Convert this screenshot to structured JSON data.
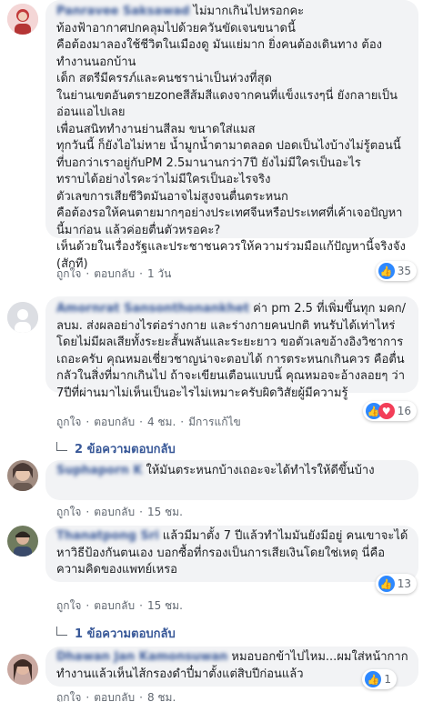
{
  "comments": [
    {
      "author": "Panravee Saksawad",
      "text": "ไม่มากเกินไปหรอกคะ\nท้องฟ้าอากาศปกคลุมไปด้วยควันขัดเจนขนาดนี้\nคือต้องมาลองใช้ชีวิตในเมืองดู มันแย่มาก ยิ่งคนต้องเดินทาง ต้องทำงานนอกบ้าน\nเด็ก สตรีมีครรภ์และคนชราน่าเป็นห่วงที่สุด\nในย่านเขตอันตรายzoneสีส้มสีแดงจากคนที่แข็งแรงๆนี่ ยังกลายเป็นอ่อนแอไปเลย\nเพื่อนสนิททำงานย่านสีลม ขนาดใส่แมส\nทุกวันนี้ ก็ยังไอไม่หาย น้ำมูกน้ำตามาตลอด ปอดเป็นไงบ้างไม่รู้ตอนนี้\nที่บอกว่าเราอยู่กับPM 2.5มานานกว่า7ปี ยังไม่มีใครเป็นอะไร\nทราบได้อย่างไรคะว่าไม่มีใครเป็นอะไรจริง\nตัวเลขการเสียชีวิตมันอาจไม่สูงจนตื่นตระหนก\nคือต้องรอให้คนตายมากๆอย่างประเทศจีนหรือประเทศที่เค้าเจอปัญหานี้มาก่อน แล้วค่อยตื่นตัวหรอคะ?\nเห็นด้วยในเรื่องรัฐและประชาชนควรให้ความร่วมมือแก้ปัญหานี้จริงจัง (สักที)",
      "like": "ถูกใจ",
      "reply": "ตอบกลับ",
      "time": "1 วัน",
      "reactions": "35"
    },
    {
      "author": "Amornrat Sansonthonankhet",
      "text": "ค่า pm 2.5 ที่เพิ่มขึ้นทุก มคก/ลบม. ส่งผลอย่างไรต่อร่างกาย และร่างกายคนปกติ ทนรับได้เท่าไหร่โดยไม่มีผลเสียทั้งระยะสั้นพลันและระยะยาว ขอตัวเลขอ้างอิงวิชาการเถอะครับ คุณหมอเชี่ยวชาญน่าจะตอบได้ การตระหนกเกินควร คือตื่นกลัวในสิ่งที่มากเกินไป ถ้าจะเขียนเตือนแบบนี้ คุณหมอจะอ้างลอยๆ ว่า 7ปีที่ผ่านมาไม่เห็นเป็นอะไรไม่เหมาะครับผิดวิสัยผู้มีความรู้",
      "like": "ถูกใจ",
      "reply": "ตอบกลับ",
      "time": "4 ชม.",
      "edited": "มีการแก้ไข",
      "reactions": "16",
      "replies": "2 ข้อความตอบกลับ"
    },
    {
      "author": "Suphaporn K",
      "text": "ให้มันตระหนกบ้างเถอะจะได้ทำไรให้ดีขึ้นบ้าง",
      "like": "ถูกใจ",
      "reply": "ตอบกลับ",
      "time": "15 ชม."
    },
    {
      "author": "Thanatpong Sri",
      "text": "แล้วมีมาตั้ง 7 ปีแล้วทำไมมันยังมีอยู่ คนเขาจะได้หาวิธีป้องกันตนเอง บอกซื้อที่กรองเป็นการเสียเงินโดยใช่เหตุ นี่คือความคิดของแพทย์เหรอ",
      "like": "ถูกใจ",
      "reply": "ตอบกลับ",
      "time": "15 ชม.",
      "reactions": "13",
      "replies": "1 ข้อความตอบกลับ"
    },
    {
      "author": "Dhawan Jan Kamonsuwan",
      "text": "หมอบอกข้าไปไหม...ผมใส่หน้ากากทำงานแล้วเห็นไส้กรองดำปี๋มาตั้งแต่สิบปีก่อนแล้ว",
      "like": "ถูกใจ",
      "reply": "ตอบกลับ",
      "time": "8 ชม.",
      "reactions": "1"
    }
  ],
  "colors": {
    "like": "#2d88ff",
    "love": "#f33e58",
    "link": "#385898"
  }
}
